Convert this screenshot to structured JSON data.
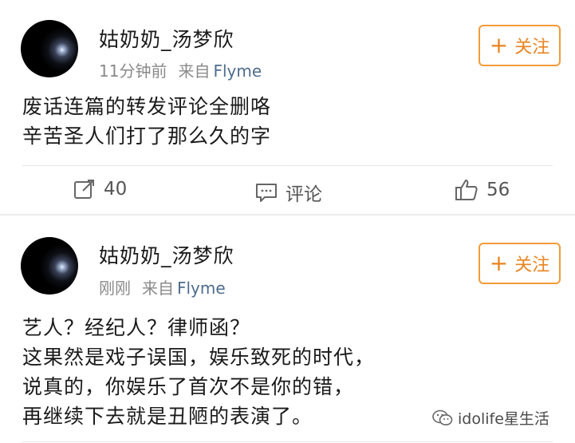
{
  "posts": [
    {
      "username": "姑奶奶_汤梦欣",
      "time": "11分钟前",
      "source_prefix": "来自",
      "source_app": "Flyme",
      "follow_label": "关注",
      "content_lines": [
        "废话连篇的转发评论全删咯",
        "辛苦圣人们打了那么久的字"
      ],
      "actions": {
        "repost_count": "40",
        "comment_label": "评论",
        "like_count": "56"
      }
    },
    {
      "username": "姑奶奶_汤梦欣",
      "time": "刚刚",
      "source_prefix": "来自",
      "source_app": "Flyme",
      "follow_label": "关注",
      "content_lines": [
        "艺人？经纪人？律师函？",
        "这果然是戏子误国，娱乐致死的时代，",
        "说真的，你娱乐了首次不是你的错，",
        "再继续下去就是丑陋的表演了。"
      ]
    }
  ],
  "watermark": "idolife星生活",
  "colors": {
    "follow_accent": "#e88420",
    "source_link": "#4f6c8c",
    "meta_text": "#8a8a8a"
  },
  "icons": [
    "repost-icon",
    "comment-icon",
    "like-icon",
    "plus-icon",
    "wechat-icon"
  ]
}
